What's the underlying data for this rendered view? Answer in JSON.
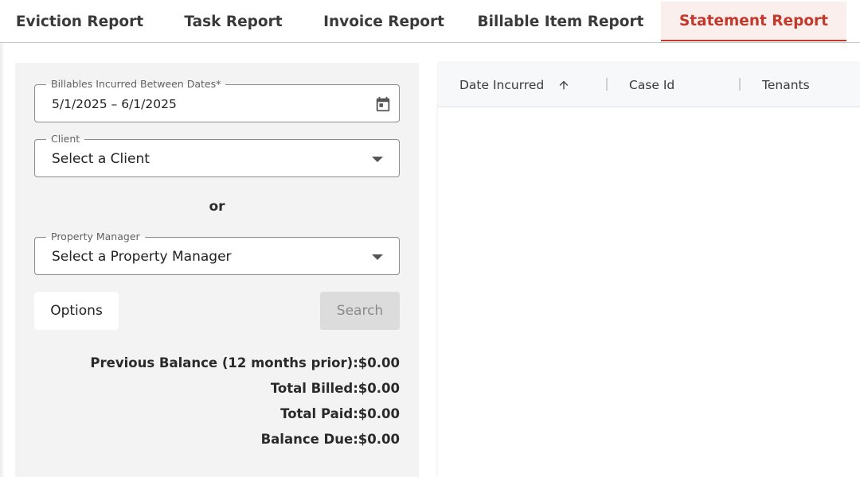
{
  "tabs": [
    {
      "label": "Eviction Report",
      "active": false
    },
    {
      "label": "Task Report",
      "active": false
    },
    {
      "label": "Invoice Report",
      "active": false
    },
    {
      "label": "Billable Item Report",
      "active": false
    },
    {
      "label": "Statement Report",
      "active": true
    }
  ],
  "form": {
    "date_range": {
      "label": "Billables Incurred Between Dates*",
      "value": "5/1/2025 – 6/1/2025",
      "icon": "calendar-icon"
    },
    "client": {
      "label": "Client",
      "placeholder": "Select a Client",
      "icon": "caret-down-icon"
    },
    "or_text": "or",
    "property_manager": {
      "label": "Property Manager",
      "placeholder": "Select a Property Manager",
      "icon": "caret-down-icon"
    },
    "options_label": "Options",
    "search_label": "Search"
  },
  "totals": [
    {
      "label": "Previous Balance (12 months prior):",
      "value": "$0.00"
    },
    {
      "label": "Total Billed:",
      "value": "$0.00"
    },
    {
      "label": "Total Paid:",
      "value": "$0.00"
    },
    {
      "label": "Balance Due:",
      "value": "$0.00"
    }
  ],
  "table": {
    "columns": [
      {
        "label": "Date Incurred",
        "sort": "ascending"
      },
      {
        "label": "Case Id"
      },
      {
        "label": "Tenants"
      }
    ],
    "rows": []
  },
  "colors": {
    "accent": "#c0392b",
    "active_tab_bg": "#fbefed",
    "panel_bg": "#f3f3f3",
    "header_bg": "#f7f8fa"
  }
}
